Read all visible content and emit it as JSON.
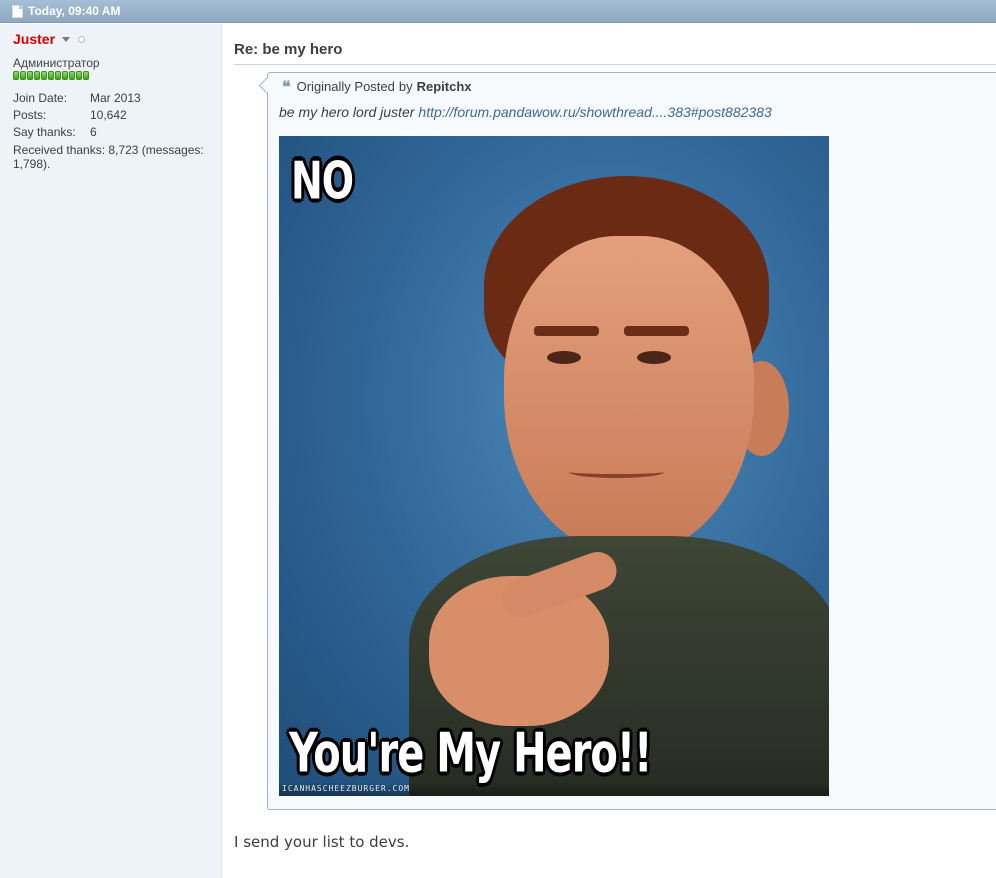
{
  "post": {
    "date": "Today, 09:40 AM",
    "title": "Re: be my hero",
    "message": "I send your list to devs."
  },
  "user": {
    "name": "Juster",
    "title": "Администратор",
    "reputation_pips": 11,
    "name_color": "#d60000",
    "info": [
      {
        "label": "Join Date:",
        "value": "Mar 2013"
      },
      {
        "label": "Posts:",
        "value": "10,642"
      },
      {
        "label": "Say thanks:",
        "value": "6"
      }
    ],
    "received_thanks": "Received thanks: 8,723 (messages: 1,798)."
  },
  "quote": {
    "prefix": "Originally Posted",
    "by": "by",
    "poster": "Repitchx",
    "text": "be my hero lord juster",
    "link": "http://forum.pandawow.ru/showthread....383#post882383"
  },
  "meme": {
    "top_text": "NO",
    "bottom_text": "You're My Hero!!",
    "footer": "ICANHASCHEEZBURGER.COM"
  },
  "colors": {
    "header_bg": "#8ea9c2",
    "sidebar_bg": "#eef3f9",
    "link": "#3d6a96"
  }
}
